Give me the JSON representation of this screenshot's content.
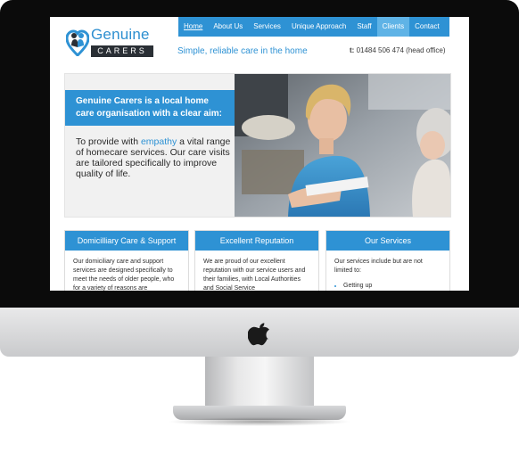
{
  "site": {
    "logo_word": "Genuine",
    "logo_sub": "CARERS",
    "tagline": "Simple, reliable care in the home",
    "phone_prefix": "t:",
    "phone_number": "01484 506 474 (head office)"
  },
  "nav": {
    "items": [
      {
        "label": "Home"
      },
      {
        "label": "About Us"
      },
      {
        "label": "Services"
      },
      {
        "label": "Unique Approach"
      },
      {
        "label": "Staff"
      },
      {
        "label": "Clients"
      },
      {
        "label": "Contact"
      }
    ]
  },
  "hero": {
    "band_text": "Genuine Carers is a local home care organisation with a clear aim:",
    "text_before": "To provide with ",
    "text_highlight": "empathy",
    "text_after": " a vital range of homecare services. Our care visits are tailored specifically to improve quality of life."
  },
  "cards": [
    {
      "title": "Domicilliary Care & Support",
      "body": "Our domiciliary care and support services are designed specifically to meet the needs of older people, who for a variety of reasons are"
    },
    {
      "title": "Excellent Reputation",
      "body": "We are proud of our excellent reputation with our service users and their families, with Local Authorities and Social Service"
    },
    {
      "title": "Our Services",
      "body": "Our services include but are not limited to:",
      "list": [
        "Getting up"
      ]
    }
  ],
  "colors": {
    "brand_blue": "#2e92d4",
    "active_nav": "#5fb3e6",
    "logo_dark": "#2a2f35"
  },
  "icons": {
    "logo": "heart-figures-icon",
    "device": "apple-logo-icon"
  }
}
